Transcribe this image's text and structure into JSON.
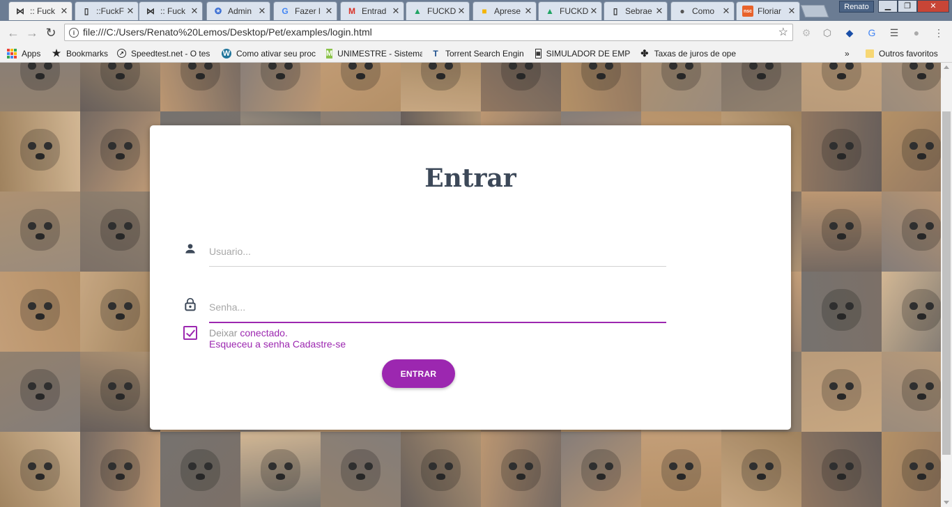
{
  "tabs": [
    {
      "title": ":: Fuck",
      "icon": "paw-icon",
      "active": true
    },
    {
      "title": "::FuckF",
      "icon": "page-icon"
    },
    {
      "title": ":: Fuck",
      "icon": "paw-icon"
    },
    {
      "title": "Admin",
      "icon": "admin-icon"
    },
    {
      "title": "Fazer l",
      "icon": "google-icon"
    },
    {
      "title": "Entrad",
      "icon": "gmail-icon"
    },
    {
      "title": "FUCKD",
      "icon": "drive-icon"
    },
    {
      "title": "Aprese",
      "icon": "slides-icon"
    },
    {
      "title": "FUCKD",
      "icon": "drive-icon"
    },
    {
      "title": "Sebrae",
      "icon": "page-icon"
    },
    {
      "title": "Como",
      "icon": "apple-icon"
    },
    {
      "title": "Floriar",
      "icon": "nsc-icon"
    }
  ],
  "profile_name": "Renato",
  "address": {
    "url": "file:///C:/Users/Renato%20Lemos/Desktop/Pet/examples/login.html"
  },
  "bookmarks": [
    {
      "label": "Apps",
      "icon": "apps-grid-icon"
    },
    {
      "label": "Bookmarks",
      "icon": "star-icon"
    },
    {
      "label": "Speedtest.net - O tes",
      "icon": "speedometer-icon"
    },
    {
      "label": "Como ativar seu proc",
      "icon": "wordpress-icon"
    },
    {
      "label": "UNIMESTRE - Sistema",
      "icon": "m-icon"
    },
    {
      "label": "Torrent Search Engin",
      "icon": "tz-icon"
    },
    {
      "label": "SIMULADOR DE EMP",
      "icon": "calculator-icon"
    },
    {
      "label": "Taxas de juros de ope",
      "icon": "bc-icon"
    }
  ],
  "bookmarks_more": "»",
  "other_bookmarks": "Outros favoritos",
  "login": {
    "title": "Entrar",
    "username_placeholder": "Usuario...",
    "password_placeholder": "Senha...",
    "remember_prefix": "Deixar",
    "remember_link": "conectado.",
    "remember_checked": true,
    "forgot_link": "Esqueceu a senha",
    "signup_link": "Cadastre-se",
    "submit_label": "ENTRAR"
  },
  "colors": {
    "accent": "#9c27b0",
    "title": "#3c4858",
    "tabstrip": "#6b7c93"
  }
}
